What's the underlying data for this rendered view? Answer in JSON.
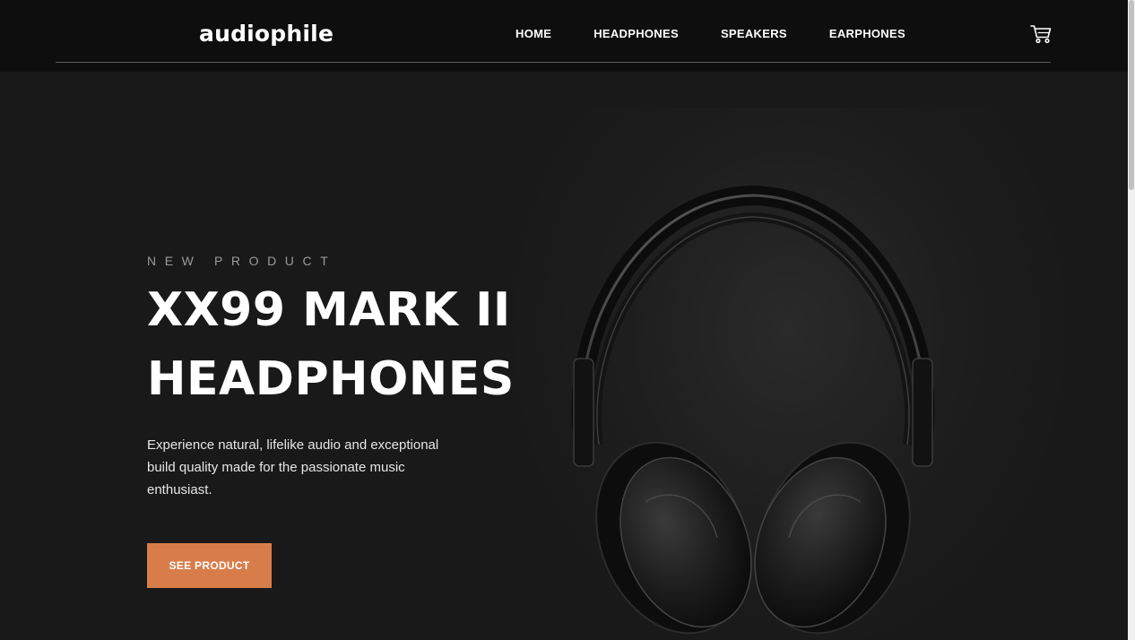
{
  "header": {
    "logo": "audiophile",
    "nav": {
      "home": "HOME",
      "headphones": "HEADPHONES",
      "speakers": "SPEAKERS",
      "earphones": "EARPHONES"
    },
    "cart_icon": "shopping-cart-icon"
  },
  "hero": {
    "overline": "NEW PRODUCT",
    "title_line1": "XX99 MARK II",
    "title_line2": "HEADPHONES",
    "description": "Experience natural, lifelike audio and exceptional build quality made for the passionate music enthusiast.",
    "cta_label": "SEE PRODUCT",
    "image_subject": "headphones-image"
  },
  "colors": {
    "accent": "#d87d4a",
    "background": "#191919",
    "header_bg": "#0e0e0e",
    "text": "#ffffff"
  }
}
